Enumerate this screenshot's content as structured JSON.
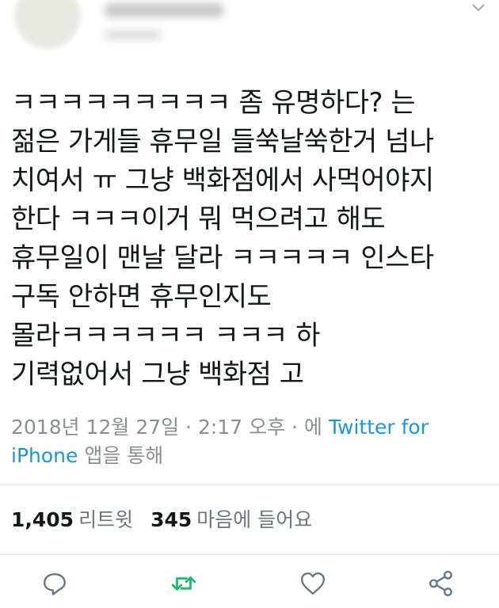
{
  "tweet": {
    "lines": [
      "ㅋㅋㅋㅋㅋㅋㅋㅋㅋ 좀 유명하다? 는",
      "젊은 가게들 휴무일 들쑥날쑥한거 넘나",
      "치여서 ㅠ 그냥 백화점에서 사먹어야지",
      "한다 ㅋㅋㅋ이거 뭐 먹으려고 해도",
      "휴무일이 맨날 달라 ㅋㅋㅋㅋㅋ 인스타",
      "구독 안하면 휴무인지도",
      "몰라ㅋㅋㅋㅋㅋㅋ ㅋㅋㅋ 하",
      "기력없어서 그냥 백화점 고"
    ]
  },
  "meta": {
    "timestamp": "2018년 12월 27일 · 2:17 오후 · 에",
    "source": "Twitter for iPhone",
    "source_suffix": "앱을 통해"
  },
  "stats": {
    "retweets_count": "1,405",
    "retweets_label": "리트윗",
    "likes_count": "345",
    "likes_label": "마음에 들어요"
  },
  "icons": {
    "reply": "reply-icon",
    "retweet": "retweet-icon",
    "like": "heart-icon",
    "share": "share-icon",
    "caret": "chevron-down-icon"
  },
  "colors": {
    "link": "#1b95e0",
    "retweet": "#17bf63",
    "muted": "#8a8d91",
    "icon": "#657786"
  }
}
